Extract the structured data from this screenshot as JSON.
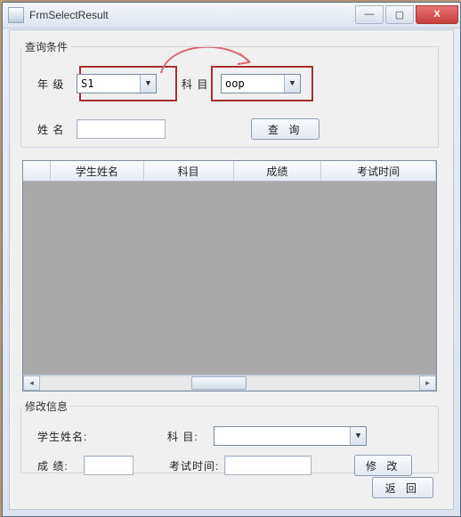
{
  "window": {
    "title": "FrmSelectResult"
  },
  "titlebar_buttons": {
    "minimize": "—",
    "maximize": "▢",
    "close": "X"
  },
  "query_group": {
    "legend": "查询条件",
    "grade_label": "年 级",
    "grade_value": "S1",
    "subject_label": "科 目",
    "subject_value": "oop",
    "name_label": "姓 名",
    "name_value": "",
    "query_button": "查 询"
  },
  "grid": {
    "columns": {
      "student_name": "学生姓名",
      "subject": "科目",
      "score": "成绩",
      "exam_time": "考试时间"
    },
    "rows": []
  },
  "edit_group": {
    "legend": "修改信息",
    "student_name_label": "学生姓名:",
    "student_name_value": "",
    "subject_label": "科 目:",
    "subject_value": "",
    "score_label": "成 绩:",
    "score_value": "",
    "exam_time_label": "考试时间:",
    "exam_time_value": "",
    "modify_button": "修 改"
  },
  "back_button": "返 回",
  "colors": {
    "highlight": "#a62f2f"
  }
}
